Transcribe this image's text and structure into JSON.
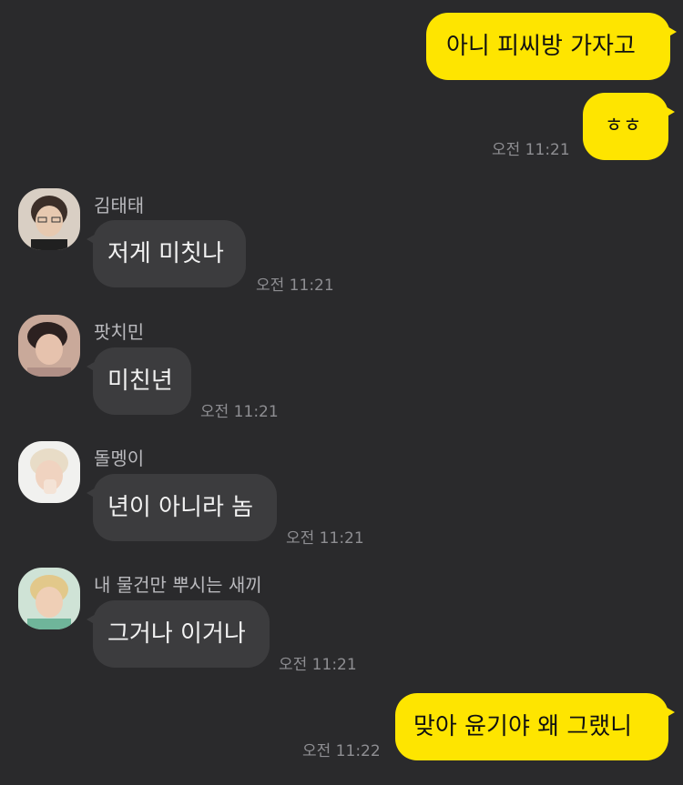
{
  "colors": {
    "background": "#2a2a2c",
    "my_bubble": "#fee500",
    "their_bubble": "#3c3c3e"
  },
  "messages": [
    {
      "sender": "me",
      "text": "아니 피씨방 가자고",
      "time": ""
    },
    {
      "sender": "me",
      "text": "ㅎㅎ",
      "time": "오전 11:21"
    },
    {
      "sender": "김태태",
      "avatar": "avatar-1",
      "text": "저게 미칫나",
      "time": "오전 11:21"
    },
    {
      "sender": "팟치민",
      "avatar": "avatar-2",
      "text": "미친년",
      "time": "오전 11:21"
    },
    {
      "sender": "돌멩이",
      "avatar": "avatar-3",
      "text": "년이 아니라 놈",
      "time": "오전 11:21"
    },
    {
      "sender": "내 물건만 뿌시는 새끼",
      "avatar": "avatar-4",
      "text": "그거나 이거나",
      "time": "오전 11:21"
    },
    {
      "sender": "me",
      "text": "맞아 윤기야 왜 그랬니",
      "time": "오전 11:22"
    }
  ]
}
